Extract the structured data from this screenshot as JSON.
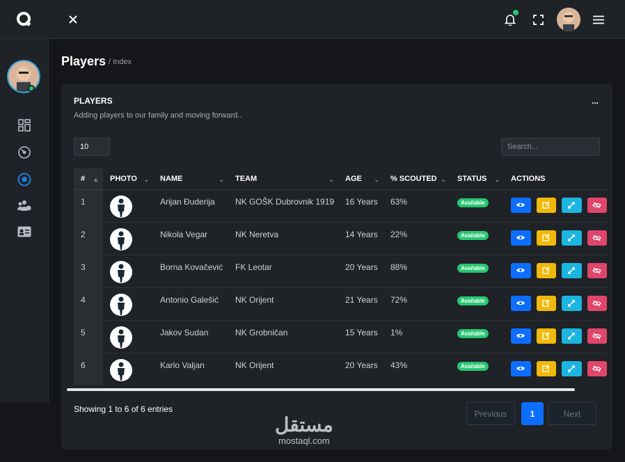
{
  "brand": {
    "logo_icon": "q-logo-icon"
  },
  "topbar": {
    "close_icon": "close-icon",
    "notification_icon": "bell-icon",
    "fullscreen_icon": "fullscreen-icon",
    "menu_icon": "hamburger-icon"
  },
  "sidebar": {
    "items": [
      {
        "name": "dashboard",
        "icon": "grid-icon"
      },
      {
        "name": "analytics",
        "icon": "gauge-icon"
      },
      {
        "name": "players",
        "icon": "soccer-ball-icon",
        "active": true
      },
      {
        "name": "users",
        "icon": "users-gear-icon"
      },
      {
        "name": "cards",
        "icon": "id-card-icon"
      }
    ]
  },
  "page": {
    "title": "Players",
    "breadcrumb": "/ Index"
  },
  "card": {
    "title": "PLAYERS",
    "subtitle": "Adding players to our family and moving forward..",
    "menu": "..."
  },
  "controls": {
    "page_length": "10",
    "search_placeholder": "Search..."
  },
  "table": {
    "columns": [
      "#",
      "PHOTO",
      "NAME",
      "TEAM",
      "AGE",
      "% SCOUTED",
      "STATUS",
      "ACTIONS"
    ],
    "rows": [
      {
        "num": "1",
        "name": "Arijan Đuderija",
        "team": "NK GOŠK Dubrovnik 1919",
        "age": "16 Years",
        "scouted": "63%",
        "status": "Available"
      },
      {
        "num": "2",
        "name": "Nikola Vegar",
        "team": "NK Neretva",
        "age": "14 Years",
        "scouted": "22%",
        "status": "Available"
      },
      {
        "num": "3",
        "name": "Borna Kovačević",
        "team": "FK Leotar",
        "age": "20 Years",
        "scouted": "88%",
        "status": "Available"
      },
      {
        "num": "4",
        "name": "Antonio Galešić",
        "team": "NK Orijent",
        "age": "21 Years",
        "scouted": "72%",
        "status": "Available"
      },
      {
        "num": "5",
        "name": "Jakov Sudan",
        "team": "NK Grobničan",
        "age": "15 Years",
        "scouted": "1%",
        "status": "Available"
      },
      {
        "num": "6",
        "name": "Karlo Valjan",
        "team": "NK Orijent",
        "age": "20 Years",
        "scouted": "43%",
        "status": "Available"
      }
    ]
  },
  "footer": {
    "info": "Showing 1 to 6 of 6 entries",
    "prev": "Previous",
    "page": "1",
    "next": "Next"
  },
  "watermark": {
    "arabic": "مستقل",
    "latin": "mostaql.com"
  },
  "colors": {
    "accent": "#0d6efd",
    "status": "#28c76f",
    "edit": "#f0b90b",
    "move": "#1cb5e0",
    "hide": "#e0466c"
  }
}
